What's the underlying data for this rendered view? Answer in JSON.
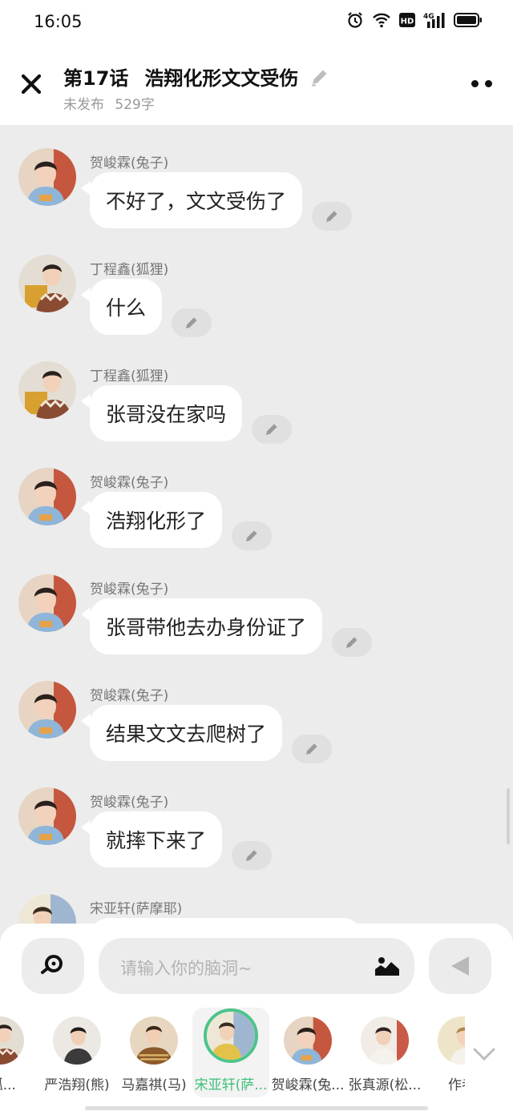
{
  "status_bar": {
    "time": "16:05",
    "icons": [
      "alarm-icon",
      "wifi-icon",
      "hd-icon",
      "signal-4g-icon",
      "battery-icon"
    ],
    "network_label": "4G",
    "hd_label": "HD"
  },
  "header": {
    "episode": "第17话",
    "title": "浩翔化形文文受伤",
    "status": "未发布",
    "word_count": "529字"
  },
  "messages": [
    {
      "sender": "贺峻霖(兔子)",
      "text": "不好了，文文受伤了",
      "avatar_theme": "rabbit"
    },
    {
      "sender": "丁程鑫(狐狸)",
      "text": "什么",
      "avatar_theme": "fox"
    },
    {
      "sender": "丁程鑫(狐狸)",
      "text": "张哥没在家吗",
      "avatar_theme": "fox"
    },
    {
      "sender": "贺峻霖(兔子)",
      "text": "浩翔化形了",
      "avatar_theme": "rabbit"
    },
    {
      "sender": "贺峻霖(兔子)",
      "text": "张哥带他去办身份证了",
      "avatar_theme": "rabbit"
    },
    {
      "sender": "贺峻霖(兔子)",
      "text": "结果文文去爬树了",
      "avatar_theme": "rabbit"
    },
    {
      "sender": "贺峻霖(兔子)",
      "text": "就摔下来了",
      "avatar_theme": "rabbit"
    },
    {
      "sender": "宋亚轩(萨摩耶)",
      "text": "",
      "avatar_theme": "samoyed"
    }
  ],
  "composer": {
    "placeholder": "请输入你的脑洞~"
  },
  "roles": [
    {
      "name": "(狐...",
      "selected": false
    },
    {
      "name": "严浩翔(熊)",
      "selected": false
    },
    {
      "name": "马嘉祺(马)",
      "selected": false
    },
    {
      "name": "宋亚轩(萨...",
      "selected": true
    },
    {
      "name": "贺峻霖(兔...",
      "selected": false
    },
    {
      "name": "张真源(松...",
      "selected": false
    },
    {
      "name": "作者",
      "selected": false
    }
  ],
  "colors": {
    "accent": "#4cc48a",
    "chat_bg": "#ececec",
    "bubble": "#ffffff"
  }
}
